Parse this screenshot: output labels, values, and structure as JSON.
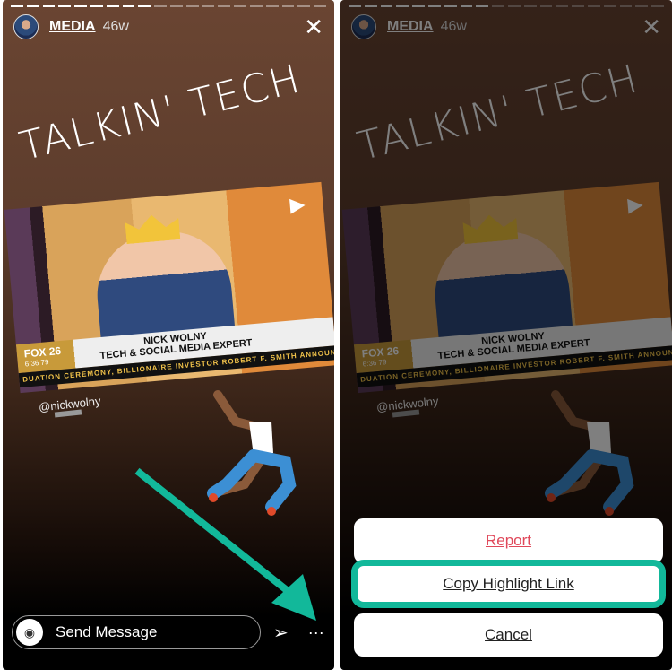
{
  "story": {
    "username": "MEDIA",
    "age": "46w",
    "title": "TALKIN' TECH",
    "segments_total": 20,
    "segments_viewed": 9
  },
  "video": {
    "name_line": "NICK WOLNY",
    "role_line": "TECH & SOCIAL MEDIA EXPERT",
    "channel": "FOX 26",
    "time": "6:36",
    "temp": "79",
    "ticker": "DUATION CEREMONY, BILLIONAIRE INVESTOR ROBERT F. SMITH ANNOUNCED HE"
  },
  "mention": "@nickwolny",
  "footer": {
    "message_placeholder": "Send Message"
  },
  "sheet": {
    "report": "Report",
    "copy_link": "Copy Highlight Link",
    "cancel": "Cancel"
  },
  "colors": {
    "highlight": "#12b89a",
    "danger": "#e0485a"
  }
}
